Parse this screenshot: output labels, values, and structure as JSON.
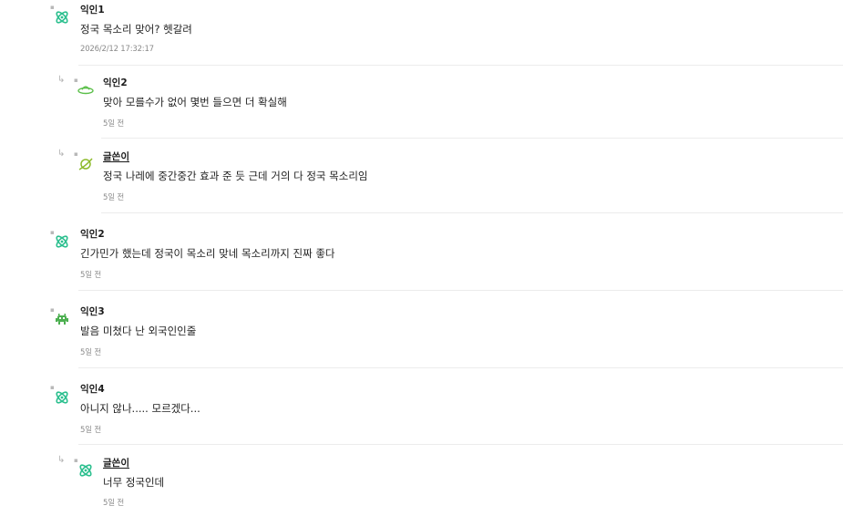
{
  "comments": [
    {
      "author": "익인1",
      "text": "정국 목소리 맞어? 헷갈려",
      "time": "2026/2/12 17:32:17",
      "icon": "atom-icon",
      "reply": false,
      "writer": false
    },
    {
      "author": "익인2",
      "text": "맞아 모를수가 없어 몇번 들으면 더 확실해",
      "time": "5일 전",
      "icon": "ufo-icon",
      "reply": true,
      "writer": false
    },
    {
      "author": "글쓴이",
      "text": "정국 나레에 중간중간 효과 준 듯 근데 거의 다 정국 목소리임",
      "time": "5일 전",
      "icon": "planet-icon",
      "reply": true,
      "writer": true
    },
    {
      "author": "익인2",
      "text": "긴가민가 했는데 정국이 목소리 맞네 목소리까지 진짜 좋다",
      "time": "5일 전",
      "icon": "atom-icon",
      "reply": false,
      "writer": false
    },
    {
      "author": "익인3",
      "text": "발음 미쳤다 난 외국인인줄",
      "time": "5일 전",
      "icon": "alien-icon",
      "reply": false,
      "writer": false
    },
    {
      "author": "익인4",
      "text": "아니지 않나..... 모르겠다...",
      "time": "5일 전",
      "icon": "atom-icon",
      "reply": false,
      "writer": false
    },
    {
      "author": "글쓴이",
      "text": "너무 정국인데",
      "time": "5일 전",
      "icon": "atom-icon",
      "reply": true,
      "writer": true
    }
  ],
  "glyphs": {
    "reply_arrow": "↳",
    "marker": "▪"
  },
  "colors": {
    "atom": "#2bbf8e",
    "ufo": "#5bbf4a",
    "planet": "#8dbb2c",
    "alien": "#4caf50"
  }
}
